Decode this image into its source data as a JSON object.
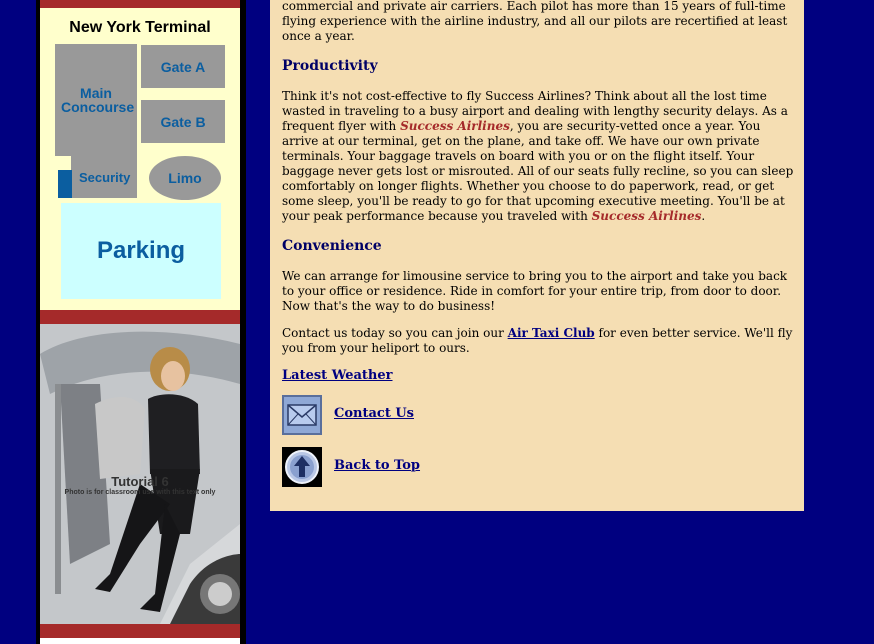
{
  "sidebar": {
    "map": {
      "title": "New York Terminal",
      "main_concourse": "Main Concourse",
      "gate_a": "Gate A",
      "gate_b": "Gate B",
      "security": "Security",
      "limo": "Limo",
      "parking": "Parking"
    },
    "photo": {
      "caption_title": "Tutorial 6",
      "caption_note": "Photo is for classroom use with this text only"
    }
  },
  "content": {
    "intro_tail": "commercial and private air carriers. Each pilot has more than 15 years of full-time flying experience with the airline industry, and all our pilots are recertified at least once a year.",
    "productivity": {
      "heading": "Productivity",
      "text_1": "Think it's not cost-effective to fly Success Airlines? Think about all the lost time wasted in traveling to a busy airport and dealing with lengthy security delays. As a frequent flyer with ",
      "brand_1": "Success Airlines",
      "text_2": ", you are security-vetted once a year. You arrive at our terminal, get on the plane, and take off. We have our own private terminals. Your baggage travels on board with you or on the flight itself. Your baggage never gets lost or misrouted. All of our seats fully recline, so you can sleep comfortably on longer flights. Whether you choose to do paperwork, read, or get some sleep, you'll be ready to go for that upcoming executive meeting. You'll be at your peak performance because you traveled with ",
      "brand_2": "Success Airlines",
      "text_3": "."
    },
    "convenience": {
      "heading": "Convenience",
      "text": "We can arrange for limousine service to bring you to the airport and take you back to your office or residence. Ride in comfort for your entire trip, from door to door. Now that's the way to do business!"
    },
    "contact": {
      "text_1": "Contact us today so you can join our ",
      "link": "Air Taxi Club",
      "text_2": " for even better service. We'll fly you from your heliport to ours."
    },
    "links": {
      "weather": "Latest Weather",
      "contact_us": "Contact Us",
      "back_to_top": "Back to Top"
    },
    "icons": {
      "contact": "envelope-icon",
      "top": "up-arrow-icon"
    }
  },
  "colors": {
    "page_background": "#000080",
    "content_background": "#f5deb3",
    "heading": "#000066",
    "brand_red": "#a52a2a",
    "map_background": "#ffffcc",
    "map_text": "#0b5ea0"
  }
}
